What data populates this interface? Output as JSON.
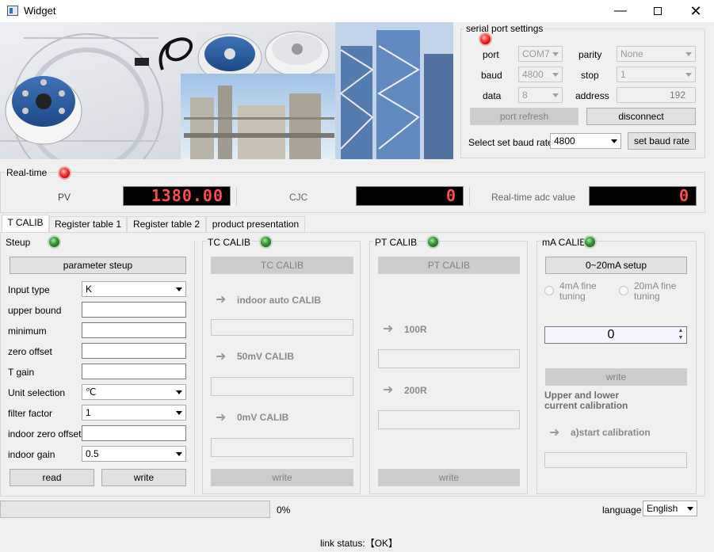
{
  "window": {
    "title": "Widget",
    "min_icon": "minimize-icon",
    "max_icon": "maximize-icon",
    "close_icon": "close-icon"
  },
  "serial": {
    "title": "serial port settings",
    "port_label": "port",
    "port_value": "COM7",
    "parity_label": "parity",
    "parity_value": "None",
    "baud_label": "baud",
    "baud_value": "4800",
    "stop_label": "stop",
    "stop_value": "1",
    "data_label": "data",
    "data_value": "8",
    "address_label": "address",
    "address_value": "192",
    "refresh_label": "port refresh",
    "disconnect_label": "disconnect",
    "setbaud_label": "Select set baud rate",
    "setbaud_value": "4800",
    "setbaud_button": "set baud rate",
    "status": "red"
  },
  "realtime": {
    "title": "Real-time",
    "pv_label": "PV",
    "pv_value": "1380.00",
    "cjc_label": "CJC",
    "cjc_value": "0",
    "adc_label": "Real-time adc value",
    "adc_value": "0",
    "status": "red"
  },
  "tabs": [
    "T CALIB",
    "Register table 1",
    "Register table 2",
    "product presentation"
  ],
  "steup": {
    "title": "Steup",
    "param_button": "parameter steup",
    "input_type_label": "Input type",
    "input_type_value": "K",
    "upper_label": "upper bound",
    "upper_value": "",
    "minimum_label": "minimum",
    "minimum_value": "",
    "zero_offset_label": "zero offset",
    "zero_offset_value": "",
    "tgain_label": "T gain",
    "tgain_value": "",
    "unit_label": "Unit selection",
    "unit_value": "℃",
    "filter_label": "filter factor",
    "filter_value": "1",
    "indoor_zero_label": "indoor zero offset",
    "indoor_zero_value": "",
    "indoor_gain_label": "indoor gain",
    "indoor_gain_value": "0.5",
    "read_button": "read",
    "write_button": "write",
    "status": "green"
  },
  "tc": {
    "title": "TC CALIB",
    "button": "TC CALIB",
    "step1": "indoor auto CALIB",
    "step2": "50mV CALIB",
    "step3": "0mV CALIB",
    "write_button": "write",
    "status": "green"
  },
  "pt": {
    "title": "PT CALIB",
    "button": "PT CALIB",
    "step1": "100R",
    "step2": "200R",
    "write_button": "write",
    "status": "green"
  },
  "ma": {
    "title": "mA CALIB",
    "setup_button": "0~20mA setup",
    "radio1": "4mA fine tuning",
    "radio2": "20mA fine tuning",
    "spin_value": "0",
    "write_button": "write",
    "desc": "Upper and lower current calibration",
    "start_label": "a)start calibration",
    "status": "green"
  },
  "progress": {
    "value": 0,
    "label": "0%"
  },
  "language": {
    "label": "language",
    "value": "English"
  },
  "link_status": "link status:【OK】"
}
